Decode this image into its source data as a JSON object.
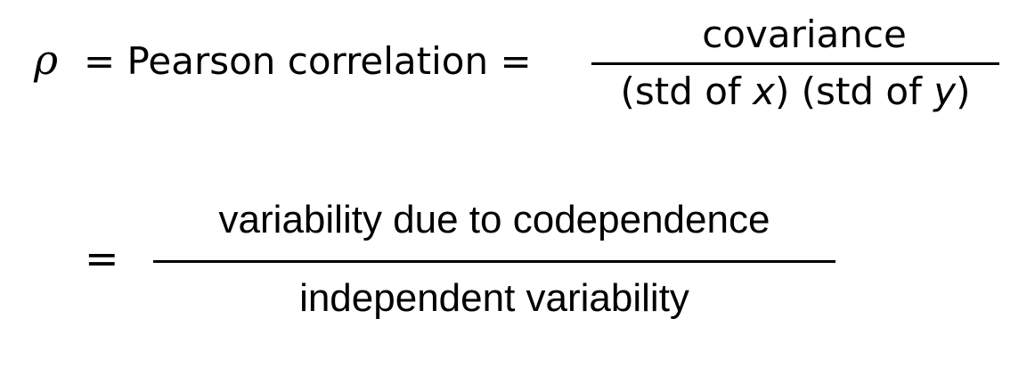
{
  "equation1": {
    "symbol": "ρ",
    "lhs_text": "= Pearson correlation =",
    "numerator": "covariance",
    "denominator": {
      "part1": "(std of ",
      "var_x": "x",
      "part2": ") (std of ",
      "var_y": "y",
      "part3": ")"
    }
  },
  "equation2": {
    "sign": "=",
    "numerator": "variability due to codependence",
    "denominator": "independent variability"
  }
}
